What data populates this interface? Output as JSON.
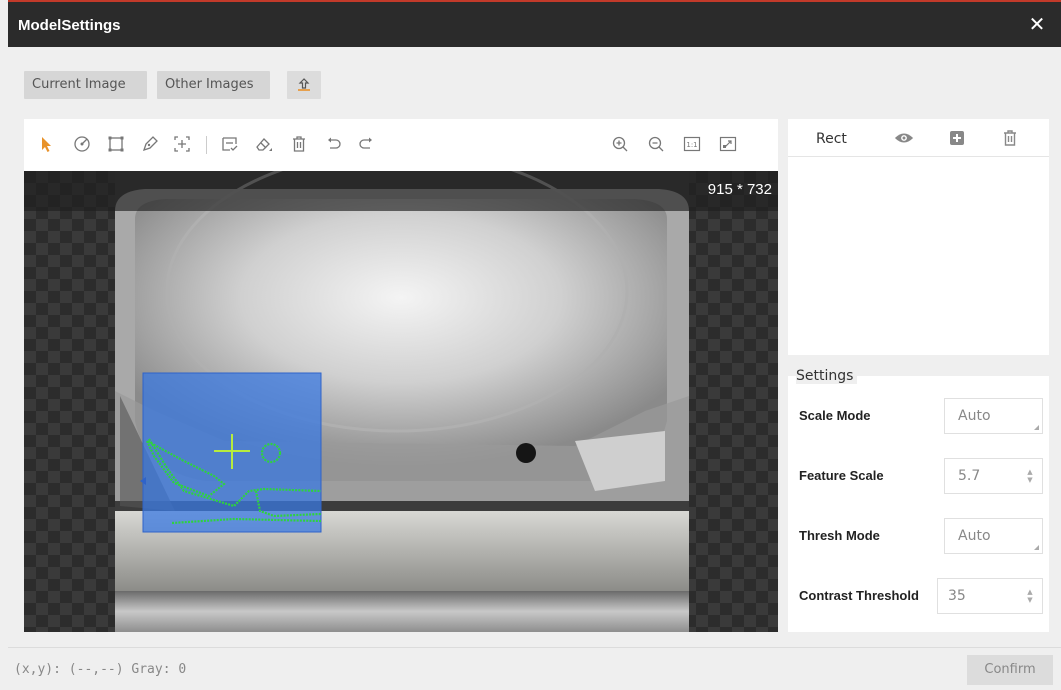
{
  "window": {
    "title": "ModelSettings",
    "close_icon": "close-icon"
  },
  "tabs": [
    {
      "label": "Current Image"
    },
    {
      "label": "Other Images"
    },
    {
      "icon": "upload-icon"
    }
  ],
  "toolbar": {
    "left_tools": [
      "pointer-icon",
      "circle-target-icon",
      "rectangle-icon",
      "polygon-pen-icon",
      "add-region-icon",
      "mask-icon",
      "eraser-icon",
      "delete-icon",
      "undo-icon",
      "redo-icon"
    ],
    "right_tools": [
      "zoom-in-icon",
      "zoom-out-icon",
      "actual-size-icon",
      "fit-window-icon"
    ],
    "actual_size_label": "1:1",
    "accent_color": "#e8922a"
  },
  "canvas": {
    "image_size_text": "915 * 732",
    "roi_color": "#3a78e0",
    "edge_color": "#2ed33e"
  },
  "roi_panel": {
    "label": "Rect",
    "icons": [
      "eye-icon",
      "add-icon",
      "trash-icon"
    ]
  },
  "settings": {
    "title": "Settings",
    "rows": [
      {
        "label": "Scale Mode",
        "value": "Auto"
      },
      {
        "label": "Feature Scale",
        "value": "5.7"
      },
      {
        "label": "Thresh Mode",
        "value": "Auto"
      },
      {
        "label": "Contrast Threshold",
        "value": "35"
      }
    ]
  },
  "status": {
    "coords_text": "(x,y): (--,--) Gray: 0",
    "confirm_label": "Confirm"
  }
}
